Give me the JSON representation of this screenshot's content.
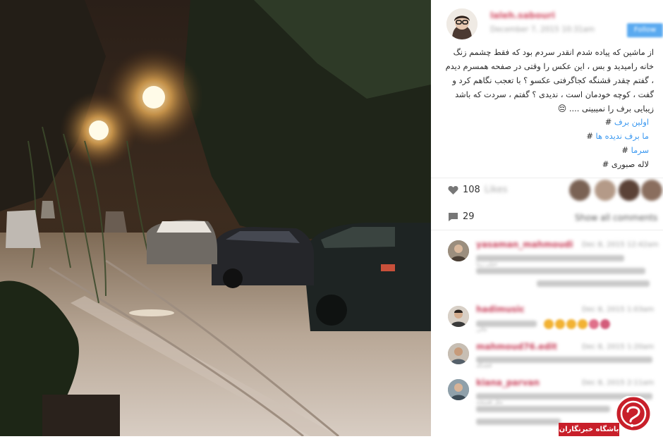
{
  "post": {
    "username": "laleh.sabouri",
    "date": "December 7, 2015 10:31am",
    "follow_label": "Follow",
    "caption": "از ماشین که پیاده شدم انقدر سردم بود که فقط چشمم زنگ خانه رامیدید و بس ، این عکس را وقتی در صفحه همسرم دیدم ، گفتم چقدر قشنگه کجاگرفتی عکسو ؟ با تعجب نگاهم کرد و گفت ، کوچه خودمان است ، ندیدی ؟ گفتم ، سردت که باشد زیبایی برف را نمیبینی ....",
    "caption_emoji": "😔",
    "hashtags": [
      "اولین برف",
      "ما برف ندیده ها",
      "سرما",
      "لاله صبوری"
    ],
    "likes_count": "108",
    "likes_label": "Likes",
    "comments_count": "29",
    "comments_label": "Show all comments"
  },
  "comments": [
    {
      "user": "yasaman_mahmoudi",
      "time": "Dec 8, 2015 12:42am",
      "text": "خیلی زیبا"
    },
    {
      "user": "hadimusic",
      "time": "Dec 8, 2015 1:03am",
      "text": "عالی"
    },
    {
      "user": "mahmoud76.edit",
      "time": "Dec 8, 2015 1:20am",
      "text": "قشنگه"
    },
    {
      "user": "kiana_parvan",
      "time": "Dec 8, 2015 2:11am",
      "text": "مثل همیشه"
    }
  ],
  "watermark": {
    "label": "باشگاه خبرنگاران"
  },
  "colors": {
    "hashtag": "#3897f0",
    "watermark_red": "#c81f2a",
    "comment_name": "#c8405a"
  }
}
